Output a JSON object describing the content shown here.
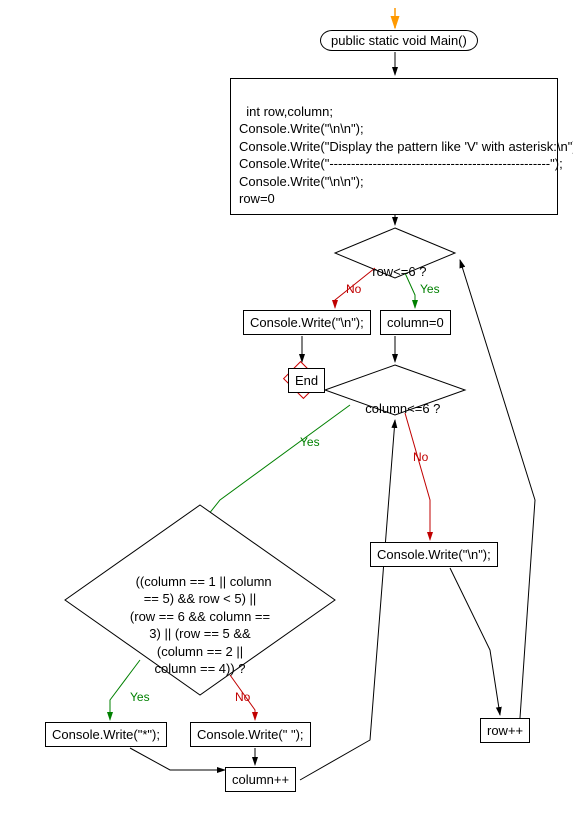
{
  "flowchart": {
    "start": "public static void Main()",
    "init_block": "int row,column;\nConsole.Write(\"\\n\\n\");\nConsole.Write(\"Display the pattern like 'V' with asterisk:\\n\");\nConsole.Write(\"---------------------------------------------------\");\nConsole.Write(\"\\n\\n\");\nrow=0",
    "decision_row": "row<=6 ?",
    "decision_col": "column<=6 ?",
    "decision_cond": "((column == 1 || column\n== 5) && row < 5) ||\n(row == 6 && column ==\n3) || (row == 5 &&\n(column == 2 ||\ncolumn == 4)) ?",
    "write_newline1": "Console.Write(\"\\n\");",
    "write_newline2": "Console.Write(\"\\n\");",
    "write_star": "Console.Write(\"*\");",
    "write_space": "Console.Write(\" \");",
    "set_column0": "column=0",
    "inc_column": "column++",
    "inc_row": "row++",
    "end": "End",
    "labels": {
      "yes": "Yes",
      "no": "No"
    }
  }
}
